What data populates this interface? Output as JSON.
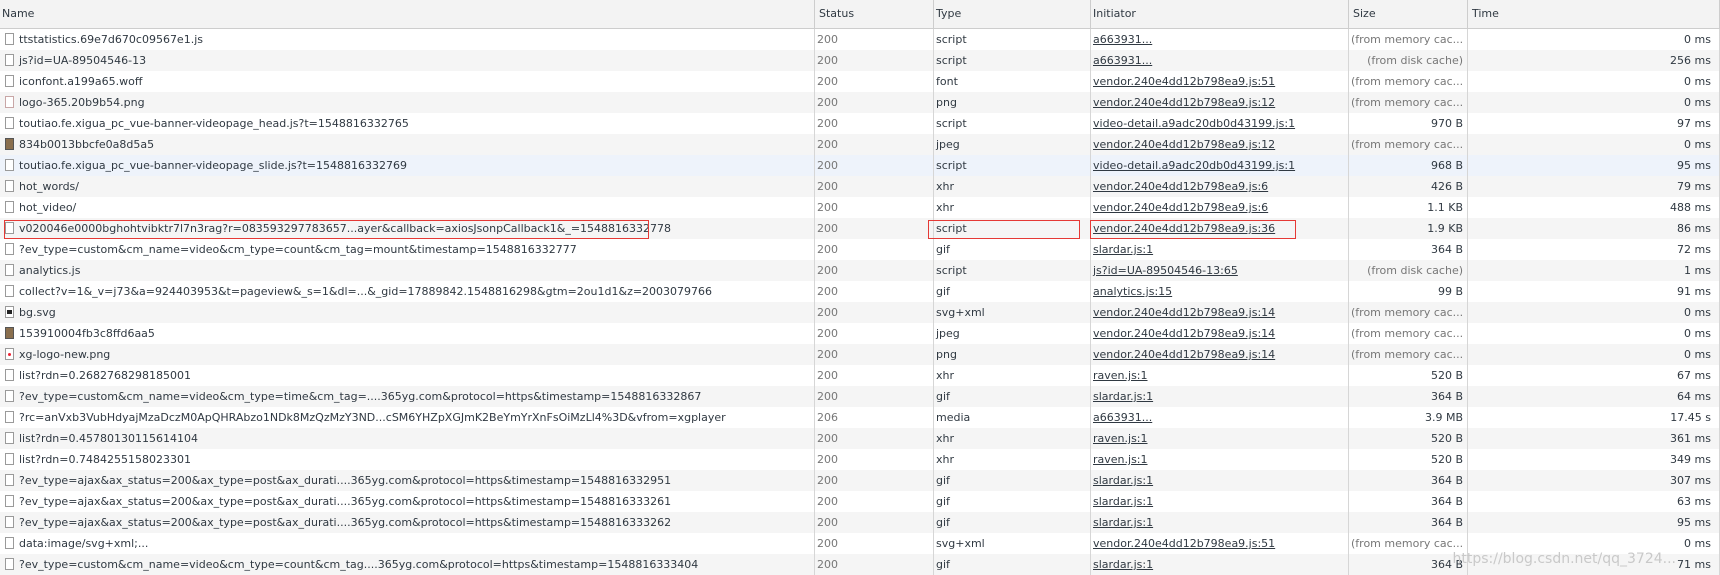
{
  "columns": {
    "name": "Name",
    "status": "Status",
    "type": "Type",
    "initiator": "Initiator",
    "size": "Size",
    "time": "Time"
  },
  "rows": [
    {
      "icon": "file-icon",
      "name": "ttstatistics.69e7d670c09567e1.js",
      "status": "200",
      "type": "script",
      "initiator": "a663931...",
      "size": "(from memory cac...",
      "time": "0 ms"
    },
    {
      "icon": "file-icon",
      "name": "js?id=UA-89504546-13",
      "status": "200",
      "type": "script",
      "initiator": "a663931...",
      "size": "(from disk cache)",
      "time": "256 ms"
    },
    {
      "icon": "file-icon",
      "name": "iconfont.a199a65.woff",
      "status": "200",
      "type": "font",
      "initiator": "vendor.240e4dd12b798ea9.js:51",
      "size": "(from memory cac...",
      "time": "0 ms"
    },
    {
      "icon": "png-icon",
      "name": "logo-365.20b9b54.png",
      "status": "200",
      "type": "png",
      "initiator": "vendor.240e4dd12b798ea9.js:12",
      "size": "(from memory cac...",
      "time": "0 ms"
    },
    {
      "icon": "file-icon",
      "name": "toutiao.fe.xigua_pc_vue-banner-videopage_head.js?t=1548816332765",
      "status": "200",
      "type": "script",
      "initiator": "video-detail.a9adc20db0d43199.js:1",
      "size": "970 B",
      "time": "97 ms"
    },
    {
      "icon": "image-icon",
      "name": "834b0013bbcfe0a8d5a5",
      "status": "200",
      "type": "jpeg",
      "initiator": "vendor.240e4dd12b798ea9.js:12",
      "size": "(from memory cac...",
      "time": "0 ms"
    },
    {
      "icon": "file-icon",
      "name": "toutiao.fe.xigua_pc_vue-banner-videopage_slide.js?t=1548816332769",
      "status": "200",
      "type": "script",
      "initiator": "video-detail.a9adc20db0d43199.js:1",
      "size": "968 B",
      "time": "95 ms"
    },
    {
      "icon": "file-icon",
      "name": "hot_words/",
      "status": "200",
      "type": "xhr",
      "initiator": "vendor.240e4dd12b798ea9.js:6",
      "size": "426 B",
      "time": "79 ms"
    },
    {
      "icon": "file-icon",
      "name": "hot_video/",
      "status": "200",
      "type": "xhr",
      "initiator": "vendor.240e4dd12b798ea9.js:6",
      "size": "1.1 KB",
      "time": "488 ms"
    },
    {
      "icon": "file-icon",
      "name": "v020046e0000bghohtvibktr7l7n3rag?r=083593297783657...ayer&callback=axiosJsonpCallback1&_=1548816332778",
      "status": "200",
      "type": "script",
      "initiator": "vendor.240e4dd12b798ea9.js:36",
      "size": "1.9 KB",
      "time": "86 ms"
    },
    {
      "icon": "file-icon",
      "name": "?ev_type=custom&cm_name=video&cm_type=count&cm_tag=mount&timestamp=1548816332777",
      "status": "200",
      "type": "gif",
      "initiator": "slardar.js:1",
      "size": "364 B",
      "time": "72 ms"
    },
    {
      "icon": "file-icon",
      "name": "analytics.js",
      "status": "200",
      "type": "script",
      "initiator": "js?id=UA-89504546-13:65",
      "size": "(from disk cache)",
      "time": "1 ms"
    },
    {
      "icon": "file-icon",
      "name": "collect?v=1&_v=j73&a=924403953&t=pageview&_s=1&dl=...&_gid=17889842.1548816298&gtm=2ou1d1&z=2003079766",
      "status": "200",
      "type": "gif",
      "initiator": "analytics.js:15",
      "size": "99 B",
      "time": "91 ms"
    },
    {
      "icon": "svg-icon",
      "name": "bg.svg",
      "status": "200",
      "type": "svg+xml",
      "initiator": "vendor.240e4dd12b798ea9.js:14",
      "size": "(from memory cac...",
      "time": "0 ms"
    },
    {
      "icon": "image-icon",
      "name": "153910004fb3c8ffd6aa5",
      "status": "200",
      "type": "jpeg",
      "initiator": "vendor.240e4dd12b798ea9.js:14",
      "size": "(from memory cac...",
      "time": "0 ms"
    },
    {
      "icon": "dot-icon",
      "name": "xg-logo-new.png",
      "status": "200",
      "type": "png",
      "initiator": "vendor.240e4dd12b798ea9.js:14",
      "size": "(from memory cac...",
      "time": "0 ms"
    },
    {
      "icon": "file-icon",
      "name": "list?rdn=0.2682768298185001",
      "status": "200",
      "type": "xhr",
      "initiator": "raven.js:1",
      "size": "520 B",
      "time": "67 ms"
    },
    {
      "icon": "file-icon",
      "name": "?ev_type=custom&cm_name=video&cm_type=time&cm_tag=....365yg.com&protocol=https&timestamp=1548816332867",
      "status": "200",
      "type": "gif",
      "initiator": "slardar.js:1",
      "size": "364 B",
      "time": "64 ms"
    },
    {
      "icon": "file-icon",
      "name": "?rc=anVxb3VubHdyajMzaDczM0ApQHRAbzo1NDk8MzQzMzY3ND...cSM6YHZpXGJmK2BeYmYrXnFsOiMzLl4%3D&vfrom=xgplayer",
      "status": "206",
      "type": "media",
      "initiator": "a663931...",
      "size": "3.9 MB",
      "time": "17.45 s"
    },
    {
      "icon": "file-icon",
      "name": "list?rdn=0.45780130115614104",
      "status": "200",
      "type": "xhr",
      "initiator": "raven.js:1",
      "size": "520 B",
      "time": "361 ms"
    },
    {
      "icon": "file-icon",
      "name": "list?rdn=0.7484255158023301",
      "status": "200",
      "type": "xhr",
      "initiator": "raven.js:1",
      "size": "520 B",
      "time": "349 ms"
    },
    {
      "icon": "file-icon",
      "name": "?ev_type=ajax&ax_status=200&ax_type=post&ax_durati....365yg.com&protocol=https&timestamp=1548816332951",
      "status": "200",
      "type": "gif",
      "initiator": "slardar.js:1",
      "size": "364 B",
      "time": "307 ms"
    },
    {
      "icon": "file-icon",
      "name": "?ev_type=ajax&ax_status=200&ax_type=post&ax_durati....365yg.com&protocol=https&timestamp=1548816333261",
      "status": "200",
      "type": "gif",
      "initiator": "slardar.js:1",
      "size": "364 B",
      "time": "63 ms"
    },
    {
      "icon": "file-icon",
      "name": "?ev_type=ajax&ax_status=200&ax_type=post&ax_durati....365yg.com&protocol=https&timestamp=1548816333262",
      "status": "200",
      "type": "gif",
      "initiator": "slardar.js:1",
      "size": "364 B",
      "time": "95 ms"
    },
    {
      "icon": "file-icon",
      "name": "data:image/svg+xml;...",
      "status": "200",
      "type": "svg+xml",
      "initiator": "vendor.240e4dd12b798ea9.js:51",
      "size": "(from memory cac...",
      "time": "0 ms"
    },
    {
      "icon": "file-icon",
      "name": "?ev_type=custom&cm_name=video&cm_type=count&cm_tag....365yg.com&protocol=https&timestamp=1548816333404",
      "status": "200",
      "type": "gif",
      "initiator": "slardar.js:1",
      "size": "364 B",
      "time": "71 ms"
    }
  ],
  "highlighted_row_index": 9,
  "watermark": "https://blog.csdn.net/qq_3724..."
}
